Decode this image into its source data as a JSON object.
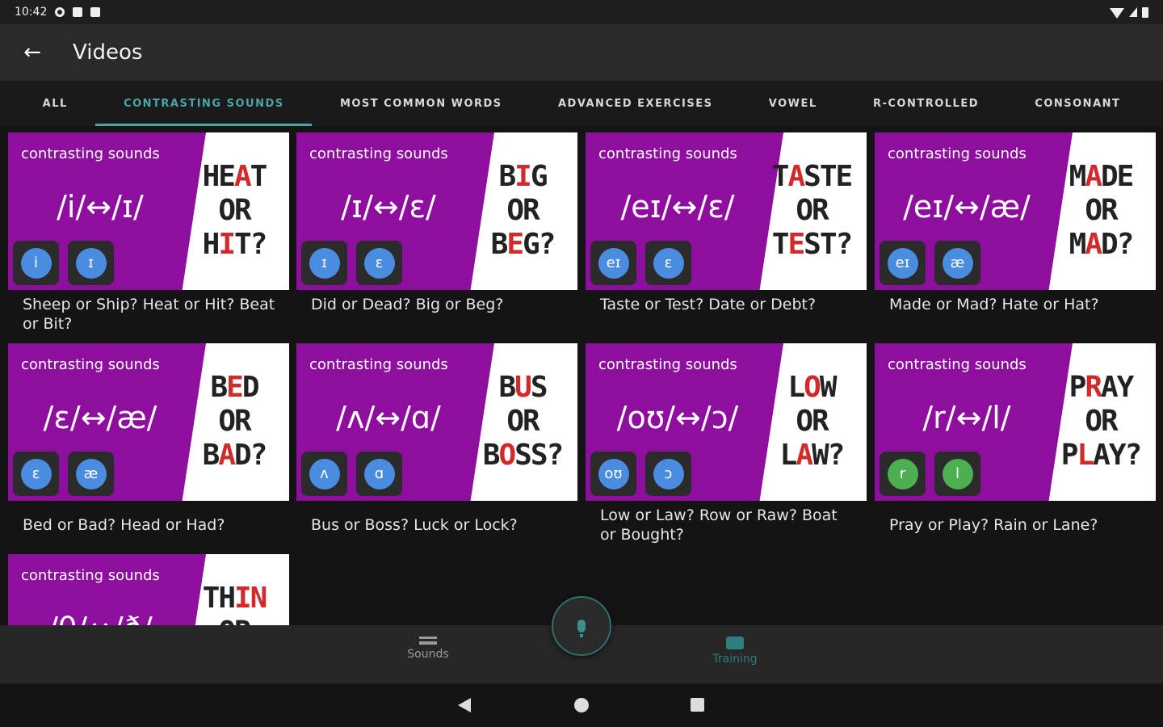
{
  "status_bar": {
    "time": "10:42"
  },
  "app_bar": {
    "title": "Videos",
    "back_icon": "arrow-back-icon"
  },
  "tabs": [
    {
      "label": "ALL"
    },
    {
      "label": "CONTRASTING SOUNDS"
    },
    {
      "label": "MOST COMMON WORDS"
    },
    {
      "label": "ADVANCED EXERCISES"
    },
    {
      "label": "VOWEL"
    },
    {
      "label": "R-CONTROLLED"
    },
    {
      "label": "CONSONANT"
    }
  ],
  "active_tab": "CONTRASTING SOUNDS",
  "colors": {
    "accent": "#4aa6a6",
    "thumb_purple": "#8e0e9e",
    "highlight_red": "#d12a2a",
    "symbol_blue": "#4a8de0",
    "symbol_green": "#4caf50"
  },
  "cards": [
    {
      "tag": "contrasting sounds",
      "phonemes": "/i/↔/ɪ/",
      "sym1": "i",
      "sym2": "ɪ",
      "w1a": "HE",
      "w1b": "A",
      "w1c": "T",
      "w2": "OR",
      "w3a": "H",
      "w3b": "I",
      "w3c": "T?",
      "caption": "Sheep or Ship? Heat or Hit? Beat or Bit?"
    },
    {
      "tag": "contrasting sounds",
      "phonemes": "/ɪ/↔/ɛ/",
      "sym1": "ɪ",
      "sym2": "ɛ",
      "w1a": "B",
      "w1b": "I",
      "w1c": "G",
      "w2": "OR",
      "w3a": "B",
      "w3b": "E",
      "w3c": "G?",
      "caption": "Did or Dead? Big or Beg?"
    },
    {
      "tag": "contrasting sounds",
      "phonemes": "/eɪ/↔/ɛ/",
      "sym1": "eɪ",
      "sym2": "ɛ",
      "w1a": "T",
      "w1b": "A",
      "w1c": "STE",
      "w2": "OR",
      "w3a": "T",
      "w3b": "E",
      "w3c": "ST?",
      "caption": "Taste or Test? Date or Debt?"
    },
    {
      "tag": "contrasting sounds",
      "phonemes": "/eɪ/↔/æ/",
      "sym1": "eɪ",
      "sym2": "æ",
      "w1a": "M",
      "w1b": "A",
      "w1c": "DE",
      "w2": "OR",
      "w3a": "M",
      "w3b": "A",
      "w3c": "D?",
      "caption": "Made or Mad? Hate or Hat?"
    },
    {
      "tag": "contrasting sounds",
      "phonemes": "/ɛ/↔/æ/",
      "sym1": "ɛ",
      "sym2": "æ",
      "w1a": "B",
      "w1b": "E",
      "w1c": "D",
      "w2": "OR",
      "w3a": "B",
      "w3b": "A",
      "w3c": "D?",
      "caption": "Bed or Bad? Head or Had?"
    },
    {
      "tag": "contrasting sounds",
      "phonemes": "/ʌ/↔/ɑ/",
      "sym1": "ʌ",
      "sym2": "ɑ",
      "w1a": "B",
      "w1b": "U",
      "w1c": "S",
      "w2": "OR",
      "w3a": "B",
      "w3b": "O",
      "w3c": "SS?",
      "caption": "Bus or Boss? Luck or Lock?"
    },
    {
      "tag": "contrasting sounds",
      "phonemes": "/oʊ/↔/ɔ/",
      "sym1": "oʊ",
      "sym2": "ɔ",
      "w1a": "L",
      "w1b": "O",
      "w1c": "W",
      "w2": "OR",
      "w3a": "L",
      "w3b": "A",
      "w3c": "W?",
      "caption": "Low or Law? Row or Raw? Boat or Bought?"
    },
    {
      "tag": "contrasting sounds",
      "phonemes": "/r/↔/l/",
      "sym1": "r",
      "sym2": "l",
      "w1a": "P",
      "w1b": "R",
      "w1c": "AY",
      "w2": "OR",
      "w3a": "P",
      "w3b": "L",
      "w3c": "AY?",
      "caption": "Pray or Play? Rain or Lane?"
    },
    {
      "tag": "contrasting sounds",
      "phonemes": "/θ/↔/ð/",
      "sym1": "",
      "sym2": "",
      "w1a": "TH",
      "w1b": "IN",
      "w1c": "",
      "w2": "OR",
      "w3a": "",
      "w3b": "",
      "w3c": "",
      "caption": ""
    }
  ],
  "bottom_nav": {
    "sounds_label": "Sounds",
    "training_label": "Training"
  }
}
